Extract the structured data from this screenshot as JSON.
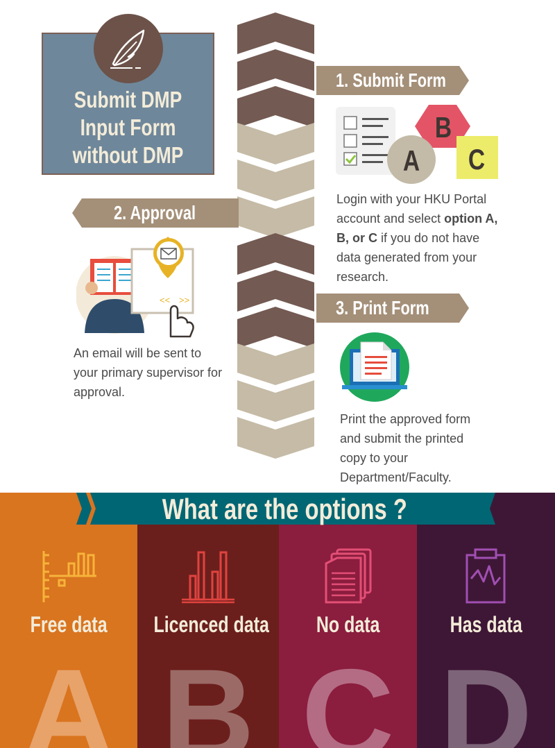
{
  "title": {
    "lines": [
      "Submit DMP",
      "Input Form",
      "without DMP"
    ]
  },
  "steps": [
    {
      "label": "1. Submit Form",
      "text_parts": [
        "Login with your HKU Portal account and select ",
        "option A, B, or C",
        " if you do not have data generated from your research."
      ],
      "icon_letters": [
        "A",
        "B",
        "C"
      ]
    },
    {
      "label": "2. Approval",
      "text": "An email will be sent to your primary supervisor for approval."
    },
    {
      "label": "3. Print Form",
      "text": "Print the approved form and submit the printed copy to your Department/Faculty."
    }
  ],
  "options": {
    "title": "What are the options ?",
    "columns": [
      {
        "label": "Free data",
        "letter": "A",
        "icon": "bar-chart-icon"
      },
      {
        "label": "Licenced data",
        "letter": "B",
        "icon": "column-chart-icon"
      },
      {
        "label": "No data",
        "letter": "C",
        "icon": "document-stack-icon"
      },
      {
        "label": "Has data",
        "letter": "D",
        "icon": "clipboard-chart-icon"
      }
    ]
  },
  "colors": {
    "chevron_dark": "#735a52",
    "chevron_light": "#c5bba6",
    "banner": "#a48f78",
    "title_box": "#6f879a",
    "option_a": "#d9741f",
    "option_b": "#6b1f1c",
    "option_c": "#8b1d3e",
    "option_d": "#3e1736",
    "ribbon": "#006674"
  }
}
